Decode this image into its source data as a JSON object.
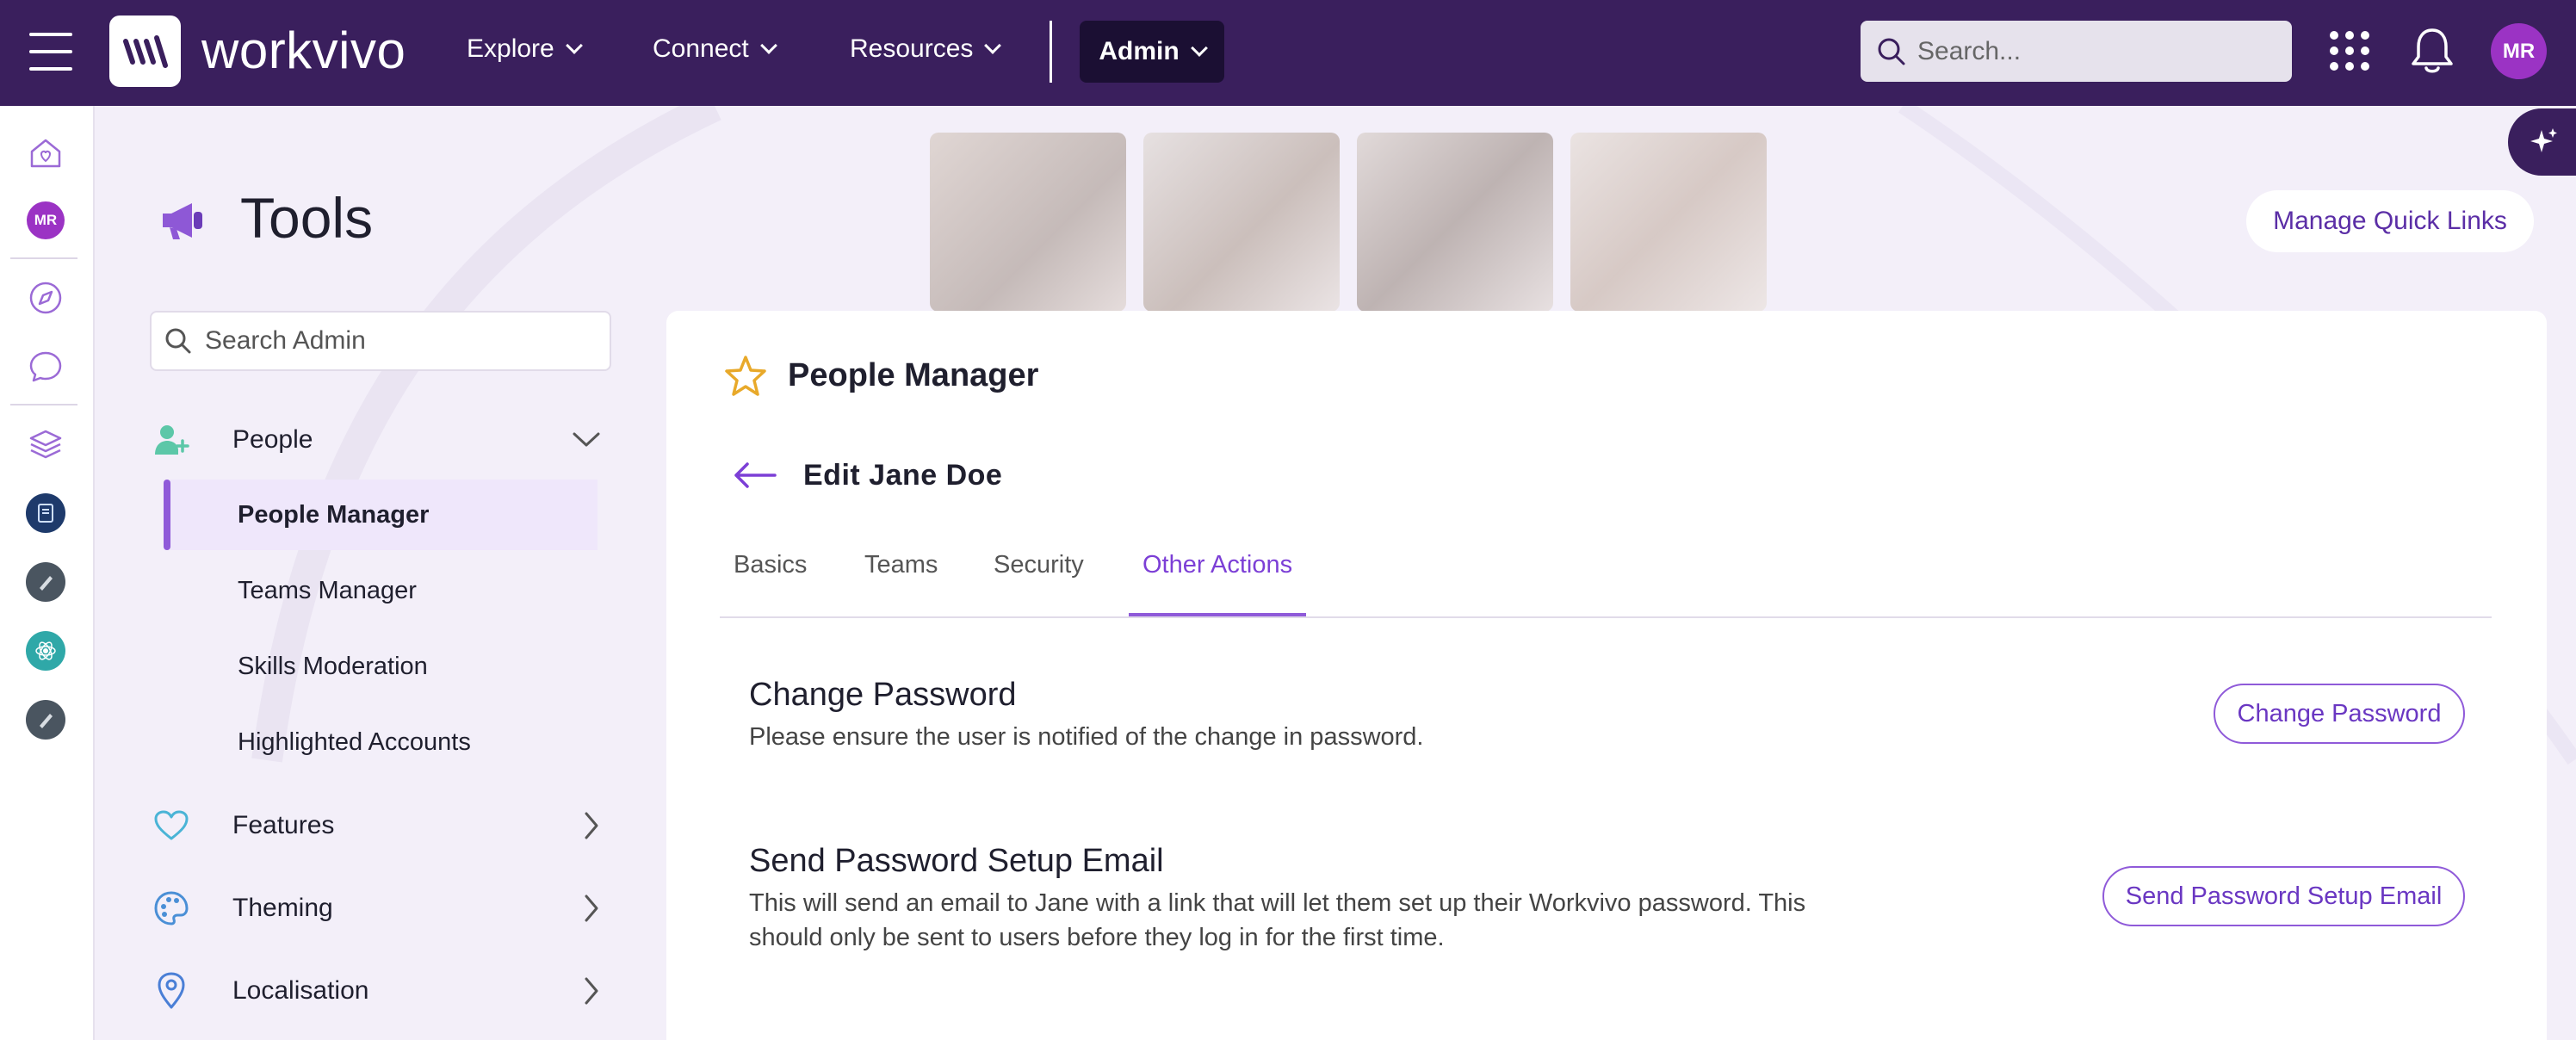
{
  "topbar": {
    "brand": "workvivo",
    "nav": [
      {
        "label": "Explore"
      },
      {
        "label": "Connect"
      },
      {
        "label": "Resources"
      }
    ],
    "admin_label": "Admin",
    "search_placeholder": "Search...",
    "avatar_initials": "MR"
  },
  "rail": {
    "avatar_initials": "MR"
  },
  "header": {
    "title": "Tools",
    "quick_links_label": "Manage Quick Links"
  },
  "admin_menu": {
    "search_placeholder": "Search Admin",
    "groups": [
      {
        "label": "People",
        "expanded": true
      },
      {
        "label": "Features"
      },
      {
        "label": "Theming"
      },
      {
        "label": "Localisation"
      }
    ],
    "people_items": [
      {
        "label": "People Manager",
        "active": true
      },
      {
        "label": "Teams Manager"
      },
      {
        "label": "Skills Moderation"
      },
      {
        "label": "Highlighted Accounts"
      }
    ]
  },
  "main": {
    "title": "People Manager",
    "edit_title": "Edit Jane Doe",
    "tabs": [
      {
        "label": "Basics"
      },
      {
        "label": "Teams"
      },
      {
        "label": "Security"
      },
      {
        "label": "Other Actions",
        "active": true
      }
    ],
    "sections": [
      {
        "title": "Change Password",
        "description": "Please ensure the user is notified of the change in password.",
        "button": "Change Password"
      },
      {
        "title": "Send Password Setup Email",
        "description": "This will send an email to Jane with a link that will let them set up their Workvivo password. This should only be sent to users before they log in for the first time.",
        "button": "Send Password Setup Email"
      }
    ]
  },
  "colors": {
    "topbar": "#3a1f5d",
    "accent": "#8f5ad9",
    "background": "#f3eff9"
  }
}
